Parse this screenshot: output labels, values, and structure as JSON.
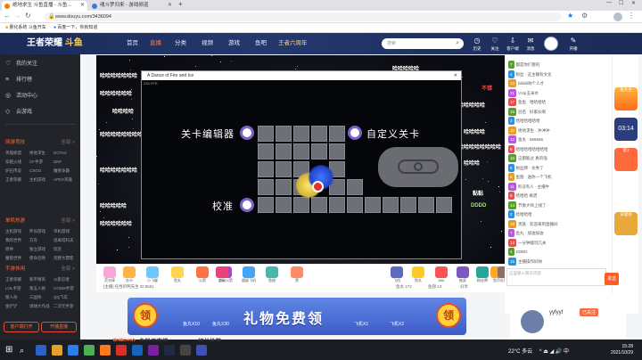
{
  "tabs": [
    {
      "label": "绝地求生 斗鱼直播 - 斗鱼...",
      "active": true
    },
    {
      "label": "魂斗罗归来 - 游戏频道",
      "active": false
    }
  ],
  "url": "www.douyu.com/3436094",
  "bookmarks": [
    "量化系统 斗鱼开车",
    "百度一下，你就知道"
  ],
  "site": {
    "logo_text": "王者荣耀",
    "logo_sub": "斗鱼",
    "nav": [
      "首页",
      "直播",
      "分类",
      "视频",
      "游戏",
      "鱼吧",
      "王者六周年"
    ],
    "search_placeholder": "搜索",
    "header_icons": [
      {
        "icon": "history-icon",
        "label": "历史"
      },
      {
        "icon": "follow-icon",
        "label": "关注"
      },
      {
        "icon": "download-icon",
        "label": "客户端"
      },
      {
        "icon": "message-icon",
        "label": "消息"
      },
      {
        "icon": "edit-icon",
        "label": "开播"
      }
    ]
  },
  "sidebar": {
    "items": [
      {
        "icon": "heart-icon",
        "label": "我的关注"
      },
      {
        "icon": "list-icon",
        "label": "排行榜"
      },
      {
        "icon": "event-icon",
        "label": "活动中心"
      },
      {
        "icon": "fish-icon",
        "label": "云游戏"
      }
    ],
    "sections": [
      {
        "title": "网游竞技",
        "more": "全部 >",
        "items": [
          "英雄联盟",
          "绝地求生",
          "DOTA2",
          "穿越火线",
          "CF手游",
          "DNF",
          "炉石传说",
          "CSGO",
          "魔兽争霸",
          "王者荣耀",
          "主机游戏",
          "APEX英雄"
        ]
      },
      {
        "title": "单机热游",
        "more": "全部 >",
        "items": [
          "主机游戏",
          "怀旧游戏",
          "单机游戏",
          "我的世界",
          "方舟",
          "逃离塔科夫",
          "原神",
          "独立游戏",
          "饥荒",
          "魔兽世界",
          "使命召唤",
          "荒野大镖客"
        ]
      },
      {
        "title": "手游休闲",
        "more": "全部 >",
        "items": [
          "王者荣耀",
          "和平精英",
          "火影忍者",
          "LOL手游",
          "第五人格",
          "CODM手游",
          "狼人杀",
          "三国杀",
          "QQ飞车",
          "金铲铲",
          "球球大作战",
          "二次元手游"
        ]
      }
    ],
    "bottom_buttons": [
      "客户端打开",
      "开播直播"
    ]
  },
  "player": {
    "danmu": [
      "哈哈哈哈哈哈哈",
      "哈哈哈哈哈哈",
      "哈哈哈哈",
      "哈哈哈哈哈哈哈哈哈",
      "哈哈哈哈哈哈哈",
      "哈哈哈哈哈",
      "哈哈哈哈哈哈",
      "哈哈哈哈哈",
      "哈哈哈哈哈哈",
      "哈哈哈哈",
      "哈哈哈哈哈哈哈哈哈",
      "哈哈哈",
      "不错",
      "黏黏",
      "DDDD"
    ],
    "game_title": "A Dance of Fire and Ice",
    "fps": "234 FPS",
    "labels": {
      "editor": "关卡编辑器",
      "custom": "自定义关卡",
      "calibrate": "校准"
    }
  },
  "gifts": [
    "荧光棒",
    "办卡",
    "小飞碟",
    "鱼丸",
    "火箭",
    "超级火箭",
    "PK",
    "超级飞机",
    "鱼翅",
    "赞",
    "飞机",
    "鱼丸",
    "666",
    "抽奖",
    "粉丝牌",
    "鱼币",
    "礼物"
  ],
  "infobar": {
    "left": "[主播] 任性的鸭先生 ID:9561",
    "right": [
      "鱼丸 172",
      "鱼翅 13",
      "分享"
    ]
  },
  "banner": {
    "title": "礼物免费领",
    "coin_left": "领",
    "coin_right": "领",
    "items": [
      "鱼丸X10",
      "鱼丸X30",
      "飞机X1",
      "飞机X2"
    ]
  },
  "below_banner": [
    "直播讨论",
    "鱼粉于直播",
    "相关推荐"
  ],
  "chat": {
    "lines": [
      {
        "level": "7",
        "text": "都是你们害的"
      },
      {
        "level": "4",
        "text": "粉丝 · 这主播有文化"
      },
      {
        "level": "13",
        "text": "bilibili呐个人才"
      },
      {
        "level": "21",
        "text": "VVip玉米水"
      },
      {
        "level": "17",
        "text": "鱼鱼 · 哈哈哈哈"
      },
      {
        "level": "18",
        "text": "冠名 · 好家伙啊"
      },
      {
        "level": "3",
        "text": "哈哈哈哈哈哈"
      },
      {
        "level": "10",
        "text": "绝地求生 · 冲冲冲"
      },
      {
        "level": "12",
        "text": "鱼丸 · 666666"
      },
      {
        "level": "9",
        "text": "哈哈哈哈哈哈哈哈"
      },
      {
        "level": "15",
        "text": "这都能过 真的强"
      },
      {
        "level": "8",
        "text": "粉丝牌 · 太秀了"
      },
      {
        "level": "6",
        "text": "鱼翅 · 送你一个飞机"
      },
      {
        "level": "11",
        "text": "有没有人 · 主播牛"
      },
      {
        "level": "5",
        "text": "哈哈哈 离谱"
      },
      {
        "level": "14",
        "text": "节奏大师上线了"
      },
      {
        "level": "2",
        "text": "哈哈哈哈"
      },
      {
        "level": "19",
        "text": "贵族 · 欢迎来到直播间"
      },
      {
        "level": "7",
        "text": "鱼丸 · 加油加油"
      },
      {
        "level": "13",
        "text": "一分钟能玩几关"
      },
      {
        "level": "4",
        "text": "DDDD"
      },
      {
        "level": "16",
        "text": "主播操作好帅"
      }
    ],
    "input_placeholder": "这里输入聊天内容",
    "send": "发送",
    "timer": "03:14",
    "rank_labels": [
      "鱼丸主",
      "第1",
      "贡献榜"
    ]
  },
  "anchor": {
    "name": "yyfyyf",
    "status": "已关注"
  },
  "taskbar": {
    "time": "15:28",
    "date": "2021/10/29",
    "weather": "22°C 多云",
    "ime": "中"
  }
}
